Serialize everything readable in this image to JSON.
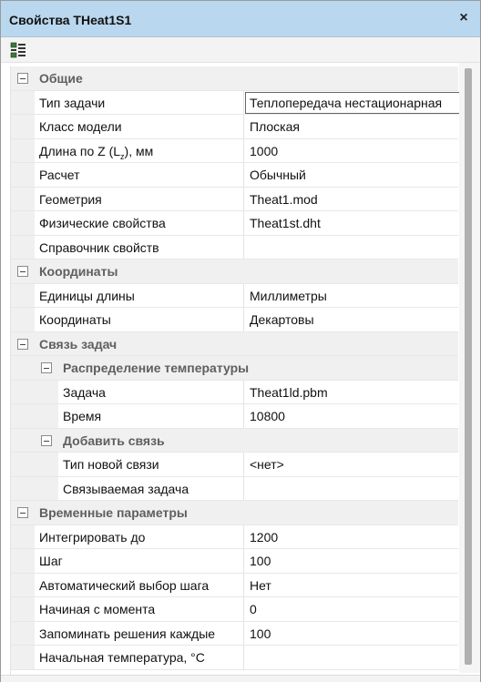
{
  "window": {
    "title": "Свойства THeat1S1",
    "close_glyph": "×"
  },
  "toolbar": {
    "categorized_icon": "categorized-view-icon"
  },
  "sections": [
    {
      "label": "Общие",
      "rows": [
        {
          "name": "Тип задачи",
          "value": "Теплопередача нестационарная"
        },
        {
          "name": "Класс модели",
          "value": "Плоская"
        },
        {
          "name_prefix": "Длина по Z (L",
          "name_sub": "z",
          "name_suffix": "), мм",
          "value": "1000"
        },
        {
          "name": "Расчет",
          "value": "Обычный"
        },
        {
          "name": "Геометрия",
          "value": "Theat1.mod"
        },
        {
          "name": "Физические свойства",
          "value": "Theat1st.dht"
        },
        {
          "name": "Справочник свойств",
          "value": ""
        }
      ]
    },
    {
      "label": "Координаты",
      "rows": [
        {
          "name": "Единицы длины",
          "value": "Миллиметры"
        },
        {
          "name": "Координаты",
          "value": "Декартовы"
        }
      ]
    },
    {
      "label": "Связь задач",
      "subsections": [
        {
          "label": "Распределение температуры",
          "rows": [
            {
              "name": "Задача",
              "value": "Theat1ld.pbm"
            },
            {
              "name": "Время",
              "value": "10800"
            }
          ]
        },
        {
          "label": "Добавить связь",
          "rows": [
            {
              "name": "Тип новой связи",
              "value": "<нет>"
            },
            {
              "name": "Связываемая задача",
              "value": ""
            }
          ]
        }
      ]
    },
    {
      "label": "Временные параметры",
      "rows": [
        {
          "name": "Интегрировать до",
          "value": "1200"
        },
        {
          "name": "Шаг",
          "value": "100"
        },
        {
          "name": "Автоматический выбор шага",
          "value": "Нет"
        },
        {
          "name": "Начиная с момента",
          "value": "0"
        },
        {
          "name": "Запоминать решения каждые",
          "value": "100"
        },
        {
          "name": "Начальная температура, °С",
          "value": ""
        }
      ]
    }
  ],
  "colors": {
    "titlebar": "#b9d7ee",
    "category_bg": "#f0f0f0",
    "category_text": "#5f5f5f"
  }
}
